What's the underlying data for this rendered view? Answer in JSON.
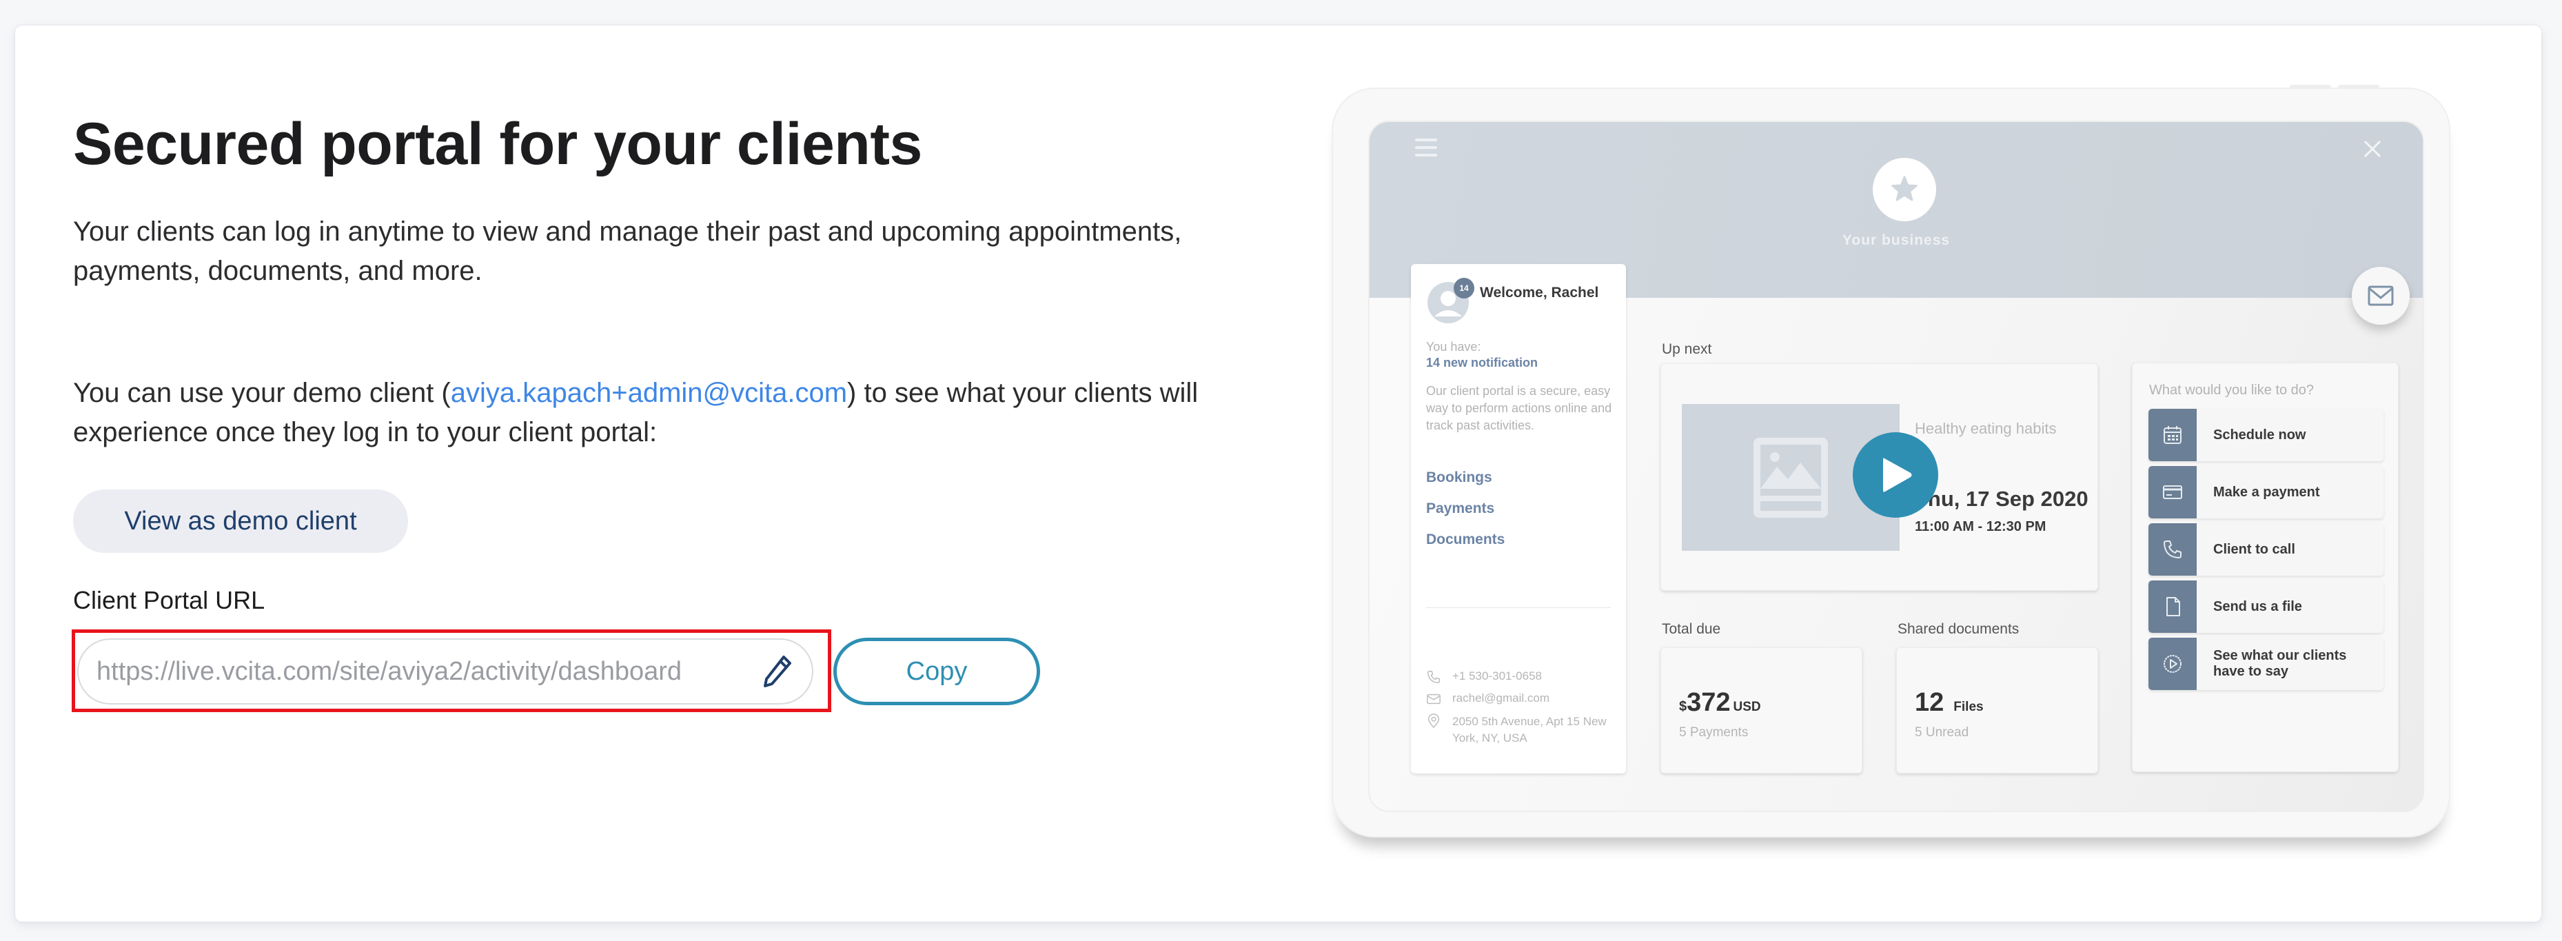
{
  "main": {
    "title": "Secured portal for your clients",
    "intro": "Your clients can log in anytime to view and manage their past and upcoming appointments, payments, documents, and more.",
    "demo_text_before": "You can use your demo client (",
    "demo_email": "aviya.kapach+admin@vcita.com",
    "demo_text_after": ") to see what your clients will experience once they log in to your client portal:",
    "view_demo_button": "View as demo client",
    "url_label": "Client Portal URL",
    "url_value": "https://live.vcita.com/site/aviya2/activity/dashboard",
    "copy_button": "Copy"
  },
  "preview": {
    "business_name": "Your business",
    "sidebar": {
      "notification_count": "14",
      "welcome": "Welcome, Rachel",
      "you_have": "You have:",
      "notifications": "14 new notification",
      "blurb": "Our client portal is a secure, easy way to perform actions online and track past activities.",
      "links": [
        "Bookings",
        "Payments",
        "Documents"
      ],
      "phone": "+1 530-301-0658",
      "email": "rachel@gmail.com",
      "address": "2050 5th Avenue, Apt 15 New York, NY, USA"
    },
    "up_next": {
      "label": "Up next",
      "event_title": "Healthy eating habits",
      "date": "Thu, 17 Sep 2020",
      "time": "11:00 AM - 12:30 PM"
    },
    "total_due": {
      "label": "Total due",
      "currency_symbol": "$",
      "amount": "372",
      "currency": "USD",
      "sub": "5 Payments"
    },
    "shared_documents": {
      "label": "Shared documents",
      "count": "12",
      "unit": "Files",
      "sub": "5 Unread"
    },
    "actions": {
      "title": "What would you like to do?",
      "items": [
        {
          "label": "Schedule now",
          "icon": "calendar-icon"
        },
        {
          "label": "Make a payment",
          "icon": "credit-card-icon"
        },
        {
          "label": "Client to call",
          "icon": "phone-icon"
        },
        {
          "label": "Send us a file",
          "icon": "file-icon"
        },
        {
          "label": "See what our clients have to say",
          "icon": "play-circle-icon"
        }
      ]
    }
  },
  "colors": {
    "accent": "#2e8fb3",
    "link": "#3d86e6",
    "highlight": "#e8141c",
    "preview_header": "#cfd6dd",
    "preview_icon_tile": "#6b7f96"
  }
}
